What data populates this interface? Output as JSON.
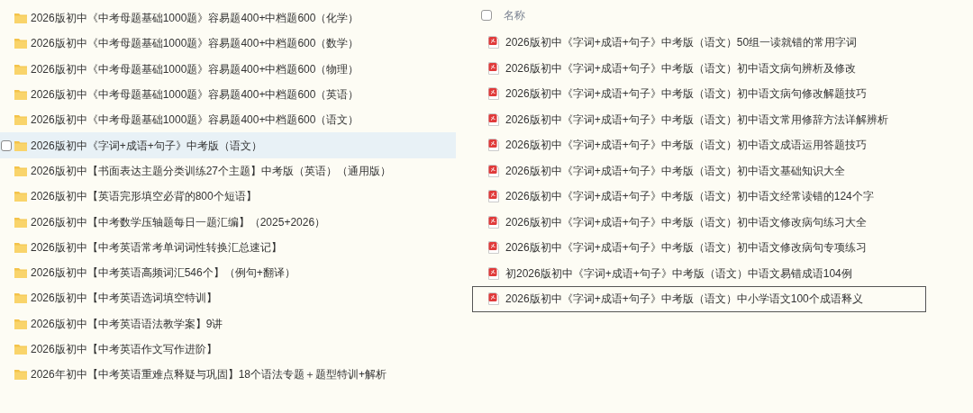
{
  "folder_list": {
    "items": [
      {
        "name": "2026版初中《中考母题基础1000题》容易题400+中档题600（化学）",
        "hovered": false
      },
      {
        "name": "2026版初中《中考母题基础1000题》容易题400+中档题600（数学）",
        "hovered": false
      },
      {
        "name": "2026版初中《中考母题基础1000题》容易题400+中档题600（物理）",
        "hovered": false
      },
      {
        "name": "2026版初中《中考母题基础1000题》容易题400+中档题600（英语）",
        "hovered": false
      },
      {
        "name": "2026版初中《中考母题基础1000题》容易题400+中档题600（语文）",
        "hovered": false
      },
      {
        "name": "2026版初中《字词+成语+句子》中考版（语文）",
        "hovered": true
      },
      {
        "name": "2026版初中【书面表达主题分类训练27个主题】中考版（英语）（通用版）",
        "hovered": false
      },
      {
        "name": "2026版初中【英语完形填空必背的800个短语】",
        "hovered": false
      },
      {
        "name": "2026版初中【中考数学压轴题每日一题汇编】（2025+2026）",
        "hovered": false
      },
      {
        "name": "2026版初中【中考英语常考单词词性转换汇总速记】",
        "hovered": false
      },
      {
        "name": "2026版初中【中考英语高频词汇546个】（例句+翻译）",
        "hovered": false
      },
      {
        "name": "2026版初中【中考英语选词填空特训】",
        "hovered": false
      },
      {
        "name": "2026版初中【中考英语语法教学案】9讲",
        "hovered": false
      },
      {
        "name": "2026版初中【中考英语作文写作进阶】",
        "hovered": false
      },
      {
        "name": "2026年初中【中考英语重难点释疑与巩固】18个语法专题＋题型特训+解析",
        "hovered": false
      }
    ]
  },
  "file_list": {
    "header": {
      "label": "名称",
      "checked": false
    },
    "items": [
      {
        "name": "2026版初中《字词+成语+句子》中考版（语文）50组一读就错的常用字词",
        "focused": false
      },
      {
        "name": "2026版初中《字词+成语+句子》中考版（语文）初中语文病句辨析及修改",
        "focused": false
      },
      {
        "name": "2026版初中《字词+成语+句子》中考版（语文）初中语文病句修改解题技巧",
        "focused": false
      },
      {
        "name": "2026版初中《字词+成语+句子》中考版（语文）初中语文常用修辞方法详解辨析",
        "focused": false
      },
      {
        "name": "2026版初中《字词+成语+句子》中考版（语文）初中语文成语运用答题技巧",
        "focused": false
      },
      {
        "name": "2026版初中《字词+成语+句子》中考版（语文）初中语文基础知识大全",
        "focused": false
      },
      {
        "name": "2026版初中《字词+成语+句子》中考版（语文）初中语文经常读错的124个字",
        "focused": false
      },
      {
        "name": "2026版初中《字词+成语+句子》中考版（语文）初中语文修改病句练习大全",
        "focused": false
      },
      {
        "name": "2026版初中《字词+成语+句子》中考版（语文）初中语文修改病句专项练习",
        "focused": false
      },
      {
        "name": "初2026版初中《字词+成语+句子》中考版（语文）中语文易错成语104例",
        "focused": false
      },
      {
        "name": "2026版初中《字词+成语+句子》中考版（语文）中小学语文100个成语释义",
        "focused": true
      }
    ]
  }
}
